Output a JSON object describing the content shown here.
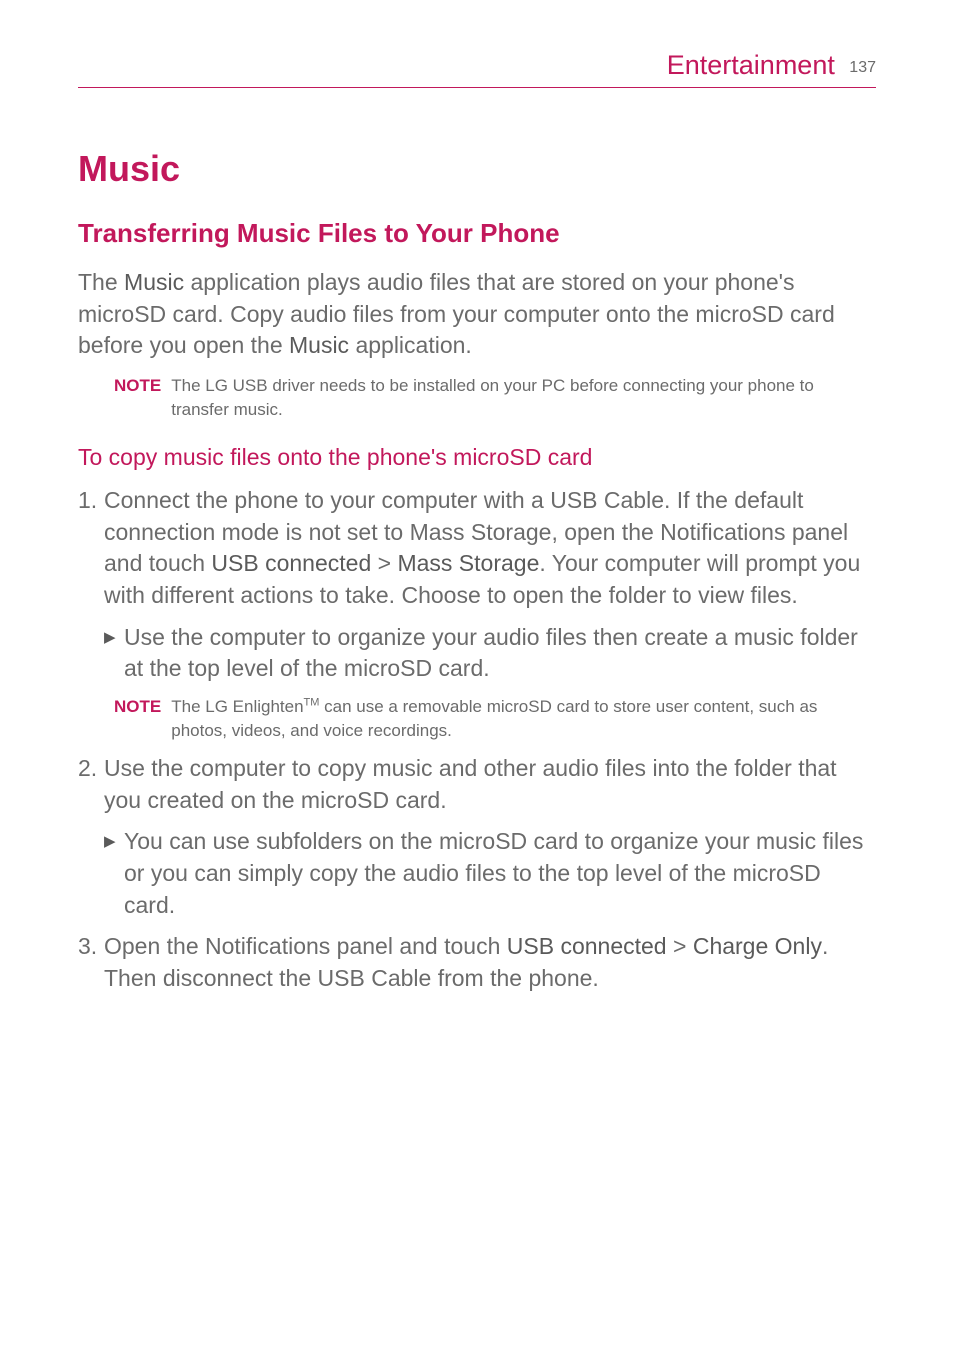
{
  "header": {
    "section": "Entertainment",
    "page": "137"
  },
  "title": "Music",
  "section_heading": "Transferring Music Files to Your Phone",
  "intro": {
    "t1": "The ",
    "b1": "Music",
    "t2": " application plays audio files that are stored on your phone's microSD card. Copy audio files from your computer onto the microSD card before you open the ",
    "b2": "Music",
    "t3": " application."
  },
  "note1": {
    "label": "NOTE",
    "text": "The LG USB driver needs to be installed on your PC before connecting your phone to transfer music."
  },
  "subsection": "To copy music files onto the phone's microSD card",
  "step1": {
    "num": "1.",
    "t1": "Connect the phone to your computer with a USB Cable. If the default connection mode is not set to Mass Storage, open the Notifications panel and touch ",
    "b1": "USB connected",
    "t2": " > ",
    "b2": "Mass Storage",
    "t3": ". Your computer will prompt you with different actions to take. Choose to open the folder to view files."
  },
  "step1_bullet": "Use the computer to organize your audio files then create a music folder at the top level of the microSD card.",
  "note2": {
    "label": "NOTE",
    "t1": "The LG Enlighten",
    "sup": "TM",
    "t2": " can use a removable microSD card to store user content, such as photos, videos, and voice recordings."
  },
  "step2": {
    "num": "2.",
    "text": "Use the computer to copy music and other audio files into the folder that you created on the microSD card."
  },
  "step2_bullet": "You can use subfolders on the microSD card to organize your music files or you can simply copy the audio files to the top level of the microSD card.",
  "step3": {
    "num": "3.",
    "t1": "Open the Notifications panel and touch ",
    "b1": "USB connected",
    "t2": " > ",
    "b2": "Charge Only",
    "t3": ". Then disconnect the USB Cable from the phone."
  }
}
